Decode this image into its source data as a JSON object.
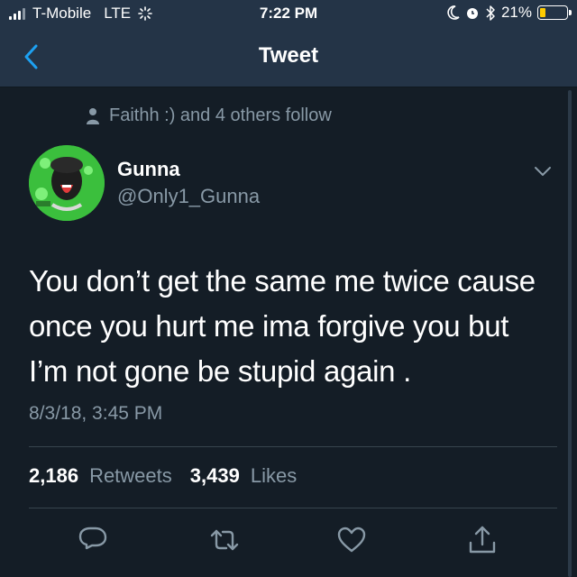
{
  "status_bar": {
    "carrier": "T-Mobile",
    "network": "LTE",
    "time": "7:22 PM",
    "battery_percent": "21%",
    "battery_level": 0.21,
    "battery_color": "#ffcc00"
  },
  "nav": {
    "title": "Tweet",
    "back_icon": "chevron-left-icon",
    "accent": "#1da1f2"
  },
  "tweet": {
    "social_context": "Faithh :) and 4 others follow",
    "name": "Gunna",
    "handle": "@Only1_Gunna",
    "text_lines": [
      "You don’t get the same me twice cause",
      "once you hurt me ima forgive you but",
      "I’m not gone be stupid again ."
    ],
    "timestamp": "8/3/18, 3:45 PM",
    "retweets_count": "2,186",
    "retweets_label": "Retweets",
    "likes_count": "3,439",
    "likes_label": "Likes"
  },
  "actions": [
    "reply-icon",
    "retweet-icon",
    "like-icon",
    "share-icon"
  ]
}
